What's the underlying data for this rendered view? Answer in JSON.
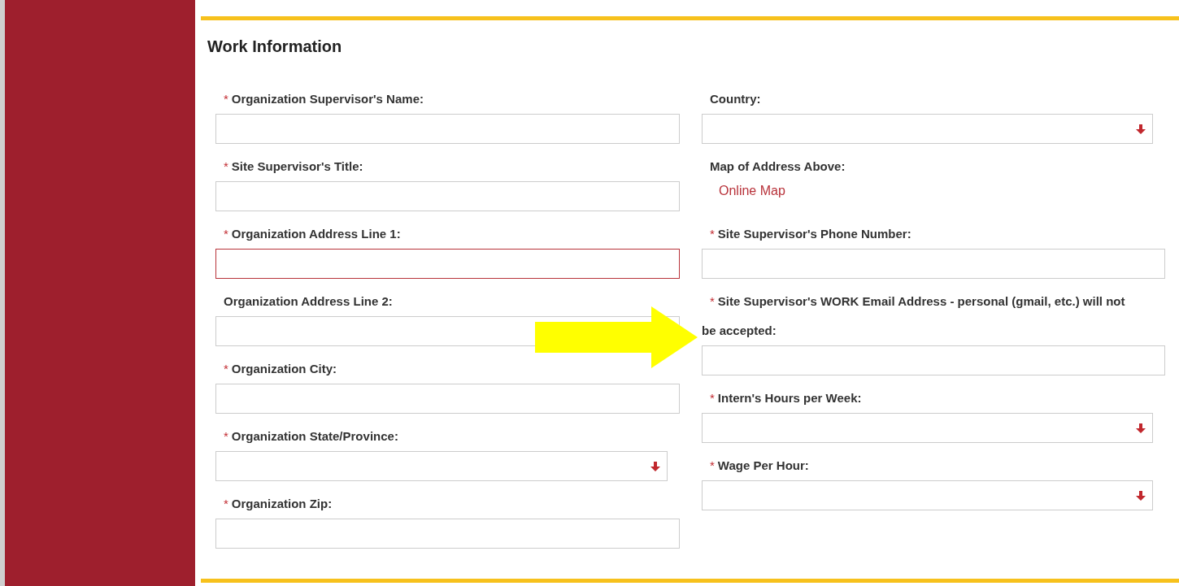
{
  "section": {
    "title": "Work Information"
  },
  "required_mark": "*",
  "left_fields": [
    {
      "kind": "text",
      "label": "Organization Supervisor's Name:",
      "required": true,
      "error": false
    },
    {
      "kind": "text",
      "label": "Site Supervisor's Title:",
      "required": true,
      "error": false
    },
    {
      "kind": "text",
      "label": "Organization Address Line 1:",
      "required": true,
      "error": true
    },
    {
      "kind": "text",
      "label": "Organization Address Line 2:",
      "required": false,
      "error": false
    },
    {
      "kind": "text",
      "label": "Organization City:",
      "required": true,
      "error": false
    },
    {
      "kind": "select",
      "label": "Organization State/Province:",
      "required": true,
      "error": false
    },
    {
      "kind": "text",
      "label": "Organization Zip:",
      "required": true,
      "error": false
    }
  ],
  "right_fields": [
    {
      "kind": "select",
      "label": "Country:",
      "required": false,
      "error": false
    },
    {
      "kind": "link",
      "label": "Map of Address Above:",
      "required": false,
      "link": "Online Map"
    },
    {
      "kind": "text",
      "label": "Site Supervisor's Phone Number:",
      "required": true,
      "error": false
    },
    {
      "kind": "text",
      "label": "Site Supervisor's WORK Email Address - personal (gmail, etc.) will not be accepted:",
      "required": true,
      "error": false
    },
    {
      "kind": "select",
      "label": "Intern's Hours per Week:",
      "required": true,
      "error": false
    },
    {
      "kind": "select",
      "label": "Wage Per Hour:",
      "required": true,
      "error": false
    }
  ]
}
